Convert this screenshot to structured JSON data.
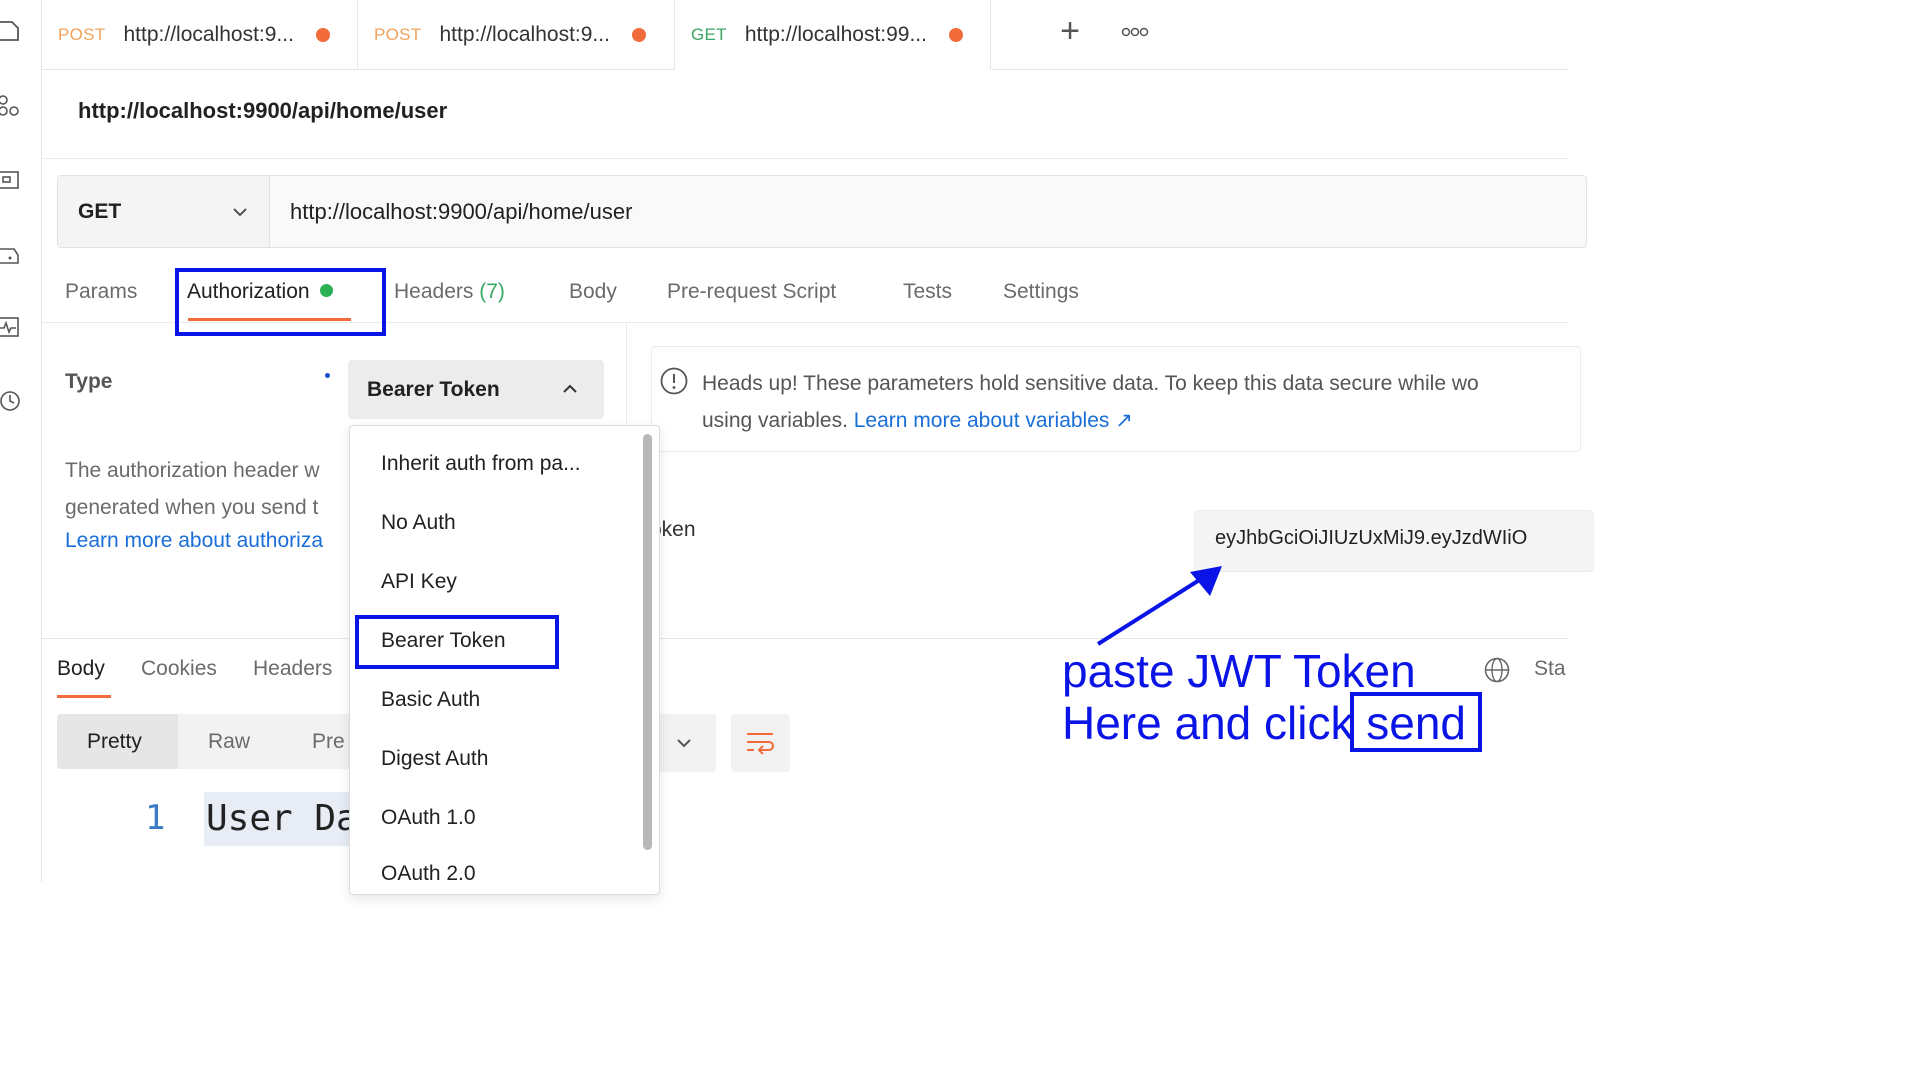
{
  "rail": {
    "icons": [
      "collections-icon",
      "apis-icon",
      "environments-icon",
      "mock-servers-icon",
      "monitors-icon",
      "history-icon"
    ]
  },
  "tabs": [
    {
      "method": "POST",
      "url": "http://localhost:9...",
      "unsaved": true
    },
    {
      "method": "POST",
      "url": "http://localhost:9...",
      "unsaved": true
    },
    {
      "method": "GET",
      "url": "http://localhost:99...",
      "unsaved": true,
      "active": true
    }
  ],
  "tabs_actions": {
    "new_tab_label": "+",
    "more_icon": "more-horizontal-icon"
  },
  "request": {
    "title": "http://localhost:9900/api/home/user",
    "method": "GET",
    "url": "http://localhost:9900/api/home/user"
  },
  "subtabs": {
    "params": "Params",
    "authorization": "Authorization",
    "headers": "Headers",
    "headers_count": "(7)",
    "body": "Body",
    "prerequest": "Pre-request Script",
    "tests": "Tests",
    "settings": "Settings"
  },
  "auth": {
    "type_label": "Type",
    "type_value": "Bearer Token",
    "desc_line1": "The authorization header w",
    "desc_line2": "generated when you send t",
    "desc_link": "Learn more about authoriza"
  },
  "notice": {
    "line1": "Heads up! These parameters hold sensitive data. To keep this data secure while wo",
    "line2_prefix": "using variables. ",
    "line2_link": "Learn more about variables ↗"
  },
  "token": {
    "label": "oken",
    "value": "eyJhbGciOiJIUzUxMiJ9.eyJzdWIiO"
  },
  "dropdown": {
    "options": [
      "Inherit auth from pa...",
      "No Auth",
      "API Key",
      "Bearer Token",
      "Basic Auth",
      "Digest Auth",
      "OAuth 1.0",
      "OAuth 2.0"
    ],
    "selected": "Bearer Token"
  },
  "response": {
    "tabs": [
      "Body",
      "Cookies",
      "Headers"
    ],
    "views": [
      "Pretty",
      "Raw",
      "Pre"
    ],
    "line_number": "1",
    "code": "User Da",
    "status_label": "Sta"
  },
  "annotation": {
    "line1": "paste JWT Token",
    "line2_prefix": "Here and click ",
    "line2_box": "send"
  },
  "colors": {
    "accent": "#f26b3a",
    "get": "#3aa564",
    "post": "#f0a35c",
    "link": "#1a6ed8",
    "annotation": "#0a14e6"
  }
}
